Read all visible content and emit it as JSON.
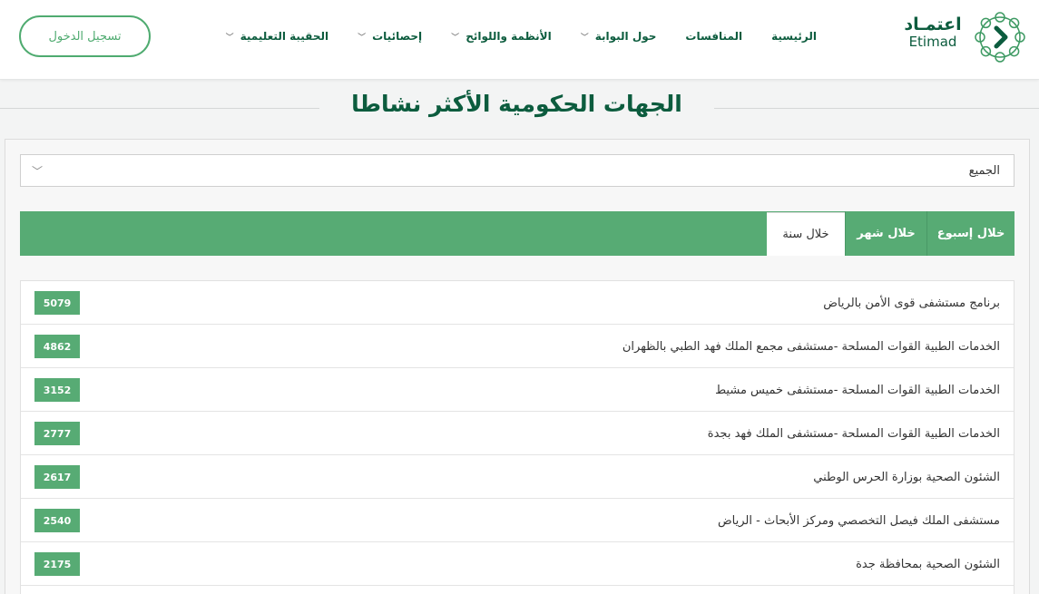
{
  "header": {
    "logo": {
      "arabic": "اعتمـاد",
      "english": "Etimad"
    },
    "nav": [
      {
        "label": "الرئيسية",
        "has_dropdown": false
      },
      {
        "label": "المنافسات",
        "has_dropdown": false
      },
      {
        "label": "حول البوابة",
        "has_dropdown": true
      },
      {
        "label": "الأنظمة واللوائح",
        "has_dropdown": true
      },
      {
        "label": "إحصائيات",
        "has_dropdown": true
      },
      {
        "label": "الحقيبة التعليمية",
        "has_dropdown": true
      }
    ],
    "login_label": "تسجيل الدخول"
  },
  "section": {
    "title": "الجهات الحكومية الأكثر نشاطا"
  },
  "filter": {
    "selected": "الجميع"
  },
  "tabs": [
    {
      "label": "خلال إسبوع",
      "active": false
    },
    {
      "label": "خلال شهر",
      "active": false
    },
    {
      "label": "خلال سنة",
      "active": true
    }
  ],
  "entities": [
    {
      "name": "برنامج مستشفى قوى الأمن بالرياض",
      "count": "5079"
    },
    {
      "name": "الخدمات الطبية القوات المسلحة -مستشفى مجمع الملك فهد الطبي بالظهران",
      "count": "4862"
    },
    {
      "name": "الخدمات الطبية القوات المسلحة -مستشفى خميس مشيط",
      "count": "3152"
    },
    {
      "name": "الخدمات الطبية القوات المسلحة -مستشفى الملك فهد بجدة",
      "count": "2777"
    },
    {
      "name": "الشئون الصحية بوزارة الحرس الوطني",
      "count": "2617"
    },
    {
      "name": "مستشفى الملك فيصل التخصصي ومركز الأبحاث - الرياض",
      "count": "2540"
    },
    {
      "name": "الشئون الصحية بمحافظة جدة",
      "count": "2175"
    }
  ],
  "colors": {
    "brand_dark": "#0c5c3e",
    "brand_green": "#57ab74",
    "login_border": "#4fab70"
  },
  "icons": {
    "logo_mark": "chevron-in-ring-icon",
    "nav_dropdown": "chevron-down-icon",
    "select_caret": "chevron-down-icon"
  }
}
